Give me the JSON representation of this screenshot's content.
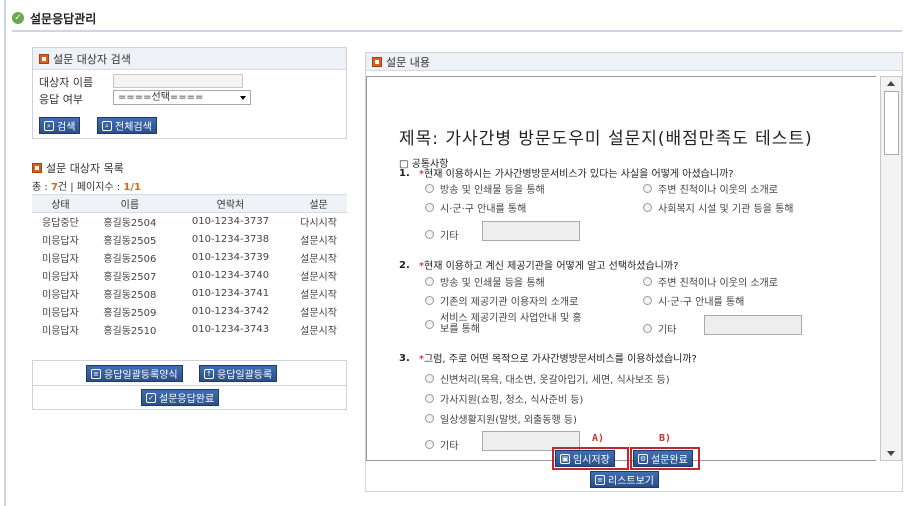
{
  "header": {
    "title": "설문응답관리"
  },
  "search": {
    "title": "설문 대상자 검색",
    "name_label": "대상자 이름",
    "response_label": "응답 여부",
    "response_selected": "====선택====",
    "search_button": "검색",
    "search_all_button": "전체검색"
  },
  "list": {
    "title": "설문 대상자 목록",
    "count_prefix": "총 : ",
    "count_value": "7",
    "count_mid": "건 | 페이지수 : ",
    "page_value": "1/1",
    "columns": [
      "상태",
      "이름",
      "연락처",
      "설문"
    ],
    "rows": [
      [
        "응답중단",
        "홍길동2504",
        "010-1234-3737",
        "다시시작"
      ],
      [
        "미응답자",
        "홍길동2505",
        "010-1234-3738",
        "설문시작"
      ],
      [
        "미응답자",
        "홍길동2506",
        "010-1234-3739",
        "설문시작"
      ],
      [
        "미응답자",
        "홍길동2507",
        "010-1234-3740",
        "설문시작"
      ],
      [
        "미응답자",
        "홍길동2508",
        "010-1234-3741",
        "설문시작"
      ],
      [
        "미응답자",
        "홍길동2509",
        "010-1234-3742",
        "설문시작"
      ],
      [
        "미응답자",
        "홍길동2510",
        "010-1234-3743",
        "설문시작"
      ]
    ]
  },
  "actions": {
    "bulk_form": "응답일괄등록양식",
    "bulk_register": "응답일괄등록",
    "complete": "설문응답완료"
  },
  "content": {
    "title": "설문 내용",
    "survey_title": "제목: 가사간병 방문도우미 설문지(배점만족도 테스트)",
    "section": "□ 공통사항",
    "questions": [
      {
        "num": "1.",
        "text": "현재 이용하시는 가사간병방문서비스가 있다는 사실을 어떻게 아셨습니까?",
        "options": [
          "방송 및 인쇄물 등을 통해",
          "주변 친척이나 이웃의 소개로",
          "시·군·구 안내를 통해",
          "사회복지 시설 및 기관 등을 통해",
          "기타"
        ]
      },
      {
        "num": "2.",
        "text": "현재 이용하고 계신 제공기관을 어떻게 알고 선택하셨습니까?",
        "options": [
          "방송 및 인쇄물 등을 통해",
          "주변 친척이나 이웃의 소개로",
          "기존의 제공기관 이용자의 소개로",
          "시·군·구 안내를 통해",
          "서비스 제공기관의 사업안내 및 홍",
          "보를 통해",
          "기타"
        ]
      },
      {
        "num": "3.",
        "text": "그럼, 주로 어떤 목적으로 가사간병방문서비스를 이용하셨습니까?",
        "options": [
          "신변처리(목욕, 대소변, 옷갈아입기, 세면, 식사보조 등)",
          "가사지원(쇼핑, 청소, 식사준비 등)",
          "일상생활지원(말벗, 외출동행 등)",
          "기타"
        ]
      }
    ],
    "annotation_a": "A)",
    "annotation_b": "B)",
    "temp_save": "임시저장",
    "survey_complete": "설문완료",
    "list_view": "리스트보기"
  }
}
